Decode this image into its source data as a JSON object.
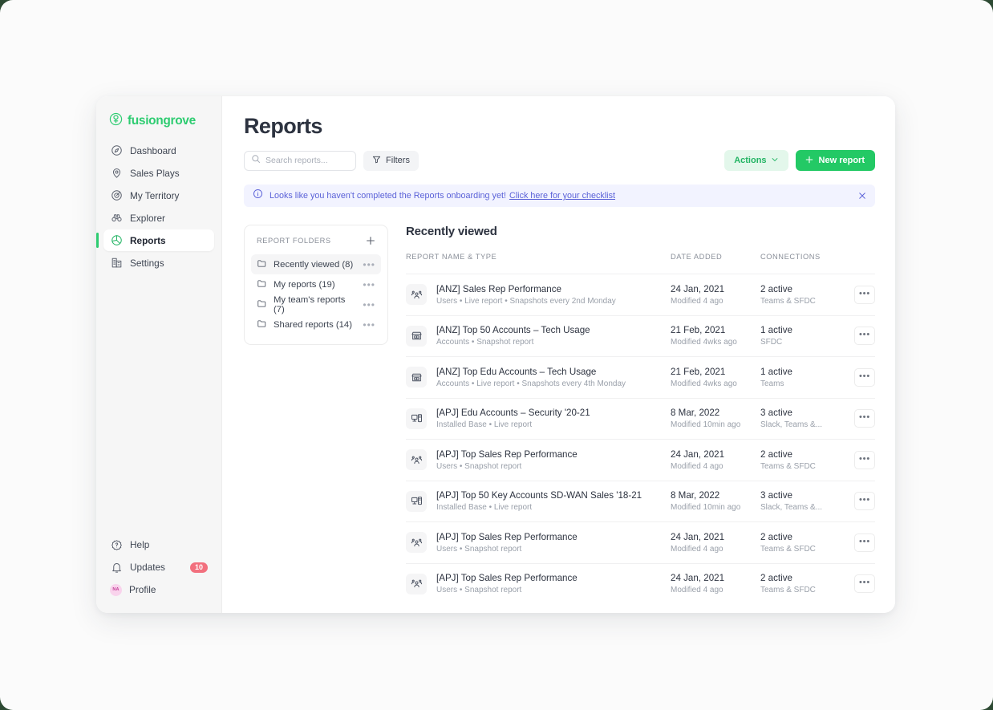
{
  "brand": {
    "name": "fusiongrove",
    "logo_icon": "tree-logo-icon",
    "color": "#2ecc71"
  },
  "sidebar": {
    "items": [
      {
        "label": "Dashboard",
        "icon": "compass-icon",
        "active": false
      },
      {
        "label": "Sales Plays",
        "icon": "map-pin-icon",
        "active": false
      },
      {
        "label": "My Territory",
        "icon": "target-icon",
        "active": false
      },
      {
        "label": "Explorer",
        "icon": "binoculars-icon",
        "active": false
      },
      {
        "label": "Reports",
        "icon": "pie-chart-icon",
        "active": true
      },
      {
        "label": "Settings",
        "icon": "building-icon",
        "active": false
      }
    ],
    "bottom": [
      {
        "label": "Help",
        "icon": "help-badge-icon"
      },
      {
        "label": "Updates",
        "icon": "bell-icon",
        "badge": "10"
      },
      {
        "label": "Profile",
        "icon": "avatar-icon",
        "avatar_initials": "NA"
      }
    ]
  },
  "header": {
    "title": "Reports"
  },
  "toolbar": {
    "search_placeholder": "Search reports...",
    "search_value": "",
    "filters_label": "Filters",
    "actions_label": "Actions",
    "new_report_label": "New report"
  },
  "banner": {
    "message": "Looks like you haven't completed the Reports onboarding yet!",
    "link_label": "Click here for your checklist",
    "accent_color": "#5b62d8"
  },
  "folders": {
    "title": "REPORT FOLDERS",
    "add_label": "+",
    "items": [
      {
        "label": "Recently viewed (8)",
        "active": true
      },
      {
        "label": "My reports (19)",
        "active": false
      },
      {
        "label": "My team's reports (7)",
        "active": false
      },
      {
        "label": "Shared reports (14)",
        "active": false
      }
    ]
  },
  "table": {
    "section_title": "Recently viewed",
    "columns": {
      "name": "REPORT NAME & TYPE",
      "date": "DATE ADDED",
      "connections": "CONNECTIONS"
    },
    "rows": [
      {
        "icon": "users-icon",
        "name": "[ANZ] Sales Rep Performance",
        "type": "Users • Live report • Snapshots every 2nd Monday",
        "date_added": "24 Jan, 2021",
        "modified": "Modified 4 ago",
        "connections_count": "2 active",
        "connections_list": "Teams & SFDC"
      },
      {
        "icon": "store-icon",
        "name": "[ANZ] Top 50 Accounts – Tech Usage",
        "type": "Accounts • Snapshot report",
        "date_added": "21 Feb, 2021",
        "modified": "Modified 4wks ago",
        "connections_count": "1 active",
        "connections_list": "SFDC"
      },
      {
        "icon": "store-icon",
        "name": "[ANZ] Top Edu Accounts – Tech Usage",
        "type": "Accounts • Live report • Snapshots every 4th Monday",
        "date_added": "21 Feb, 2021",
        "modified": "Modified 4wks ago",
        "connections_count": "1 active",
        "connections_list": "Teams"
      },
      {
        "icon": "desktop-icon",
        "name": "[APJ] Edu Accounts – Security '20-21",
        "type": "Installed Base • Live report",
        "date_added": "8 Mar, 2022",
        "modified": "Modified 10min ago",
        "connections_count": "3 active",
        "connections_list": "Slack, Teams &..."
      },
      {
        "icon": "users-icon",
        "name": "[APJ] Top Sales Rep Performance",
        "type": "Users • Snapshot report",
        "date_added": "24 Jan, 2021",
        "modified": "Modified 4 ago",
        "connections_count": "2 active",
        "connections_list": "Teams & SFDC"
      },
      {
        "icon": "desktop-icon",
        "name": "[APJ] Top 50 Key Accounts SD-WAN Sales '18-21",
        "type": "Installed Base • Live report",
        "date_added": "8 Mar, 2022",
        "modified": "Modified 10min ago",
        "connections_count": "3 active",
        "connections_list": "Slack, Teams &..."
      },
      {
        "icon": "users-icon",
        "name": "[APJ] Top Sales Rep Performance",
        "type": "Users • Snapshot report",
        "date_added": "24 Jan, 2021",
        "modified": "Modified 4 ago",
        "connections_count": "2 active",
        "connections_list": "Teams & SFDC"
      },
      {
        "icon": "users-icon",
        "name": "[APJ] Top Sales Rep Performance",
        "type": "Users • Snapshot report",
        "date_added": "24 Jan, 2021",
        "modified": "Modified 4 ago",
        "connections_count": "2 active",
        "connections_list": "Teams & SFDC"
      }
    ],
    "row_menu_label": "•••"
  }
}
